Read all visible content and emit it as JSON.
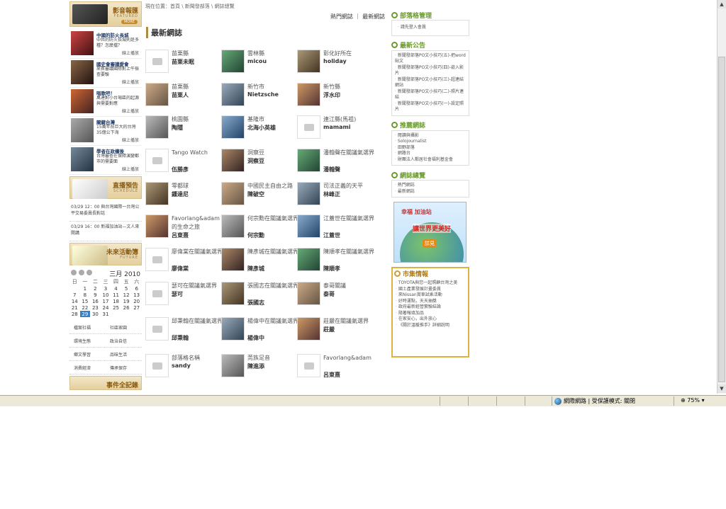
{
  "breadcrumb": "現在位置：首頁 \\ 新聞發部落 \\ 網誌總覽",
  "top_links": [
    "熱門網誌",
    "最新網誌"
  ],
  "main_title": "最新網誌",
  "left": {
    "featured_banner": {
      "title": "影音報匯",
      "sub": "FEATURED",
      "pill": "MORE"
    },
    "videos": [
      {
        "t1": "中國的防火長城",
        "t2": "中共的防火長城則是多種？怎麼擋？",
        "play": "線上播放"
      },
      {
        "t1": "國史會審議愛會",
        "t2": "來賓審議國際對上午檢查要驗",
        "play": "線上播放"
      },
      {
        "t1": "唱歌吧！",
        "t2": "萬達對小台場區的起源與需要對應",
        "play": "線上播放"
      },
      {
        "t1": "關鍵台灣",
        "t2": "15萬年前巨大的台灣35億公下海",
        "play": "線上播放"
      },
      {
        "t1": "學者在政權後",
        "t2": "台灣審查在保障演變都市的需要面",
        "play": "線上播放"
      }
    ],
    "schedule_banner": {
      "title": "直播預告",
      "sub": "SCHEDULE"
    },
    "schedule": [
      "03/29 12：00 與台灣國際一台灣公平交易委員長對話",
      "03/29 16：00 新福加油站—文人來開講"
    ],
    "future_banner": {
      "title": "未來活動簿",
      "sub": "FUTURE"
    },
    "calendar": {
      "month": "三月 2010",
      "weekdays": [
        "日",
        "一",
        "二",
        "三",
        "四",
        "五",
        "六"
      ],
      "rows": [
        [
          "",
          "1",
          "2",
          "3",
          "4",
          "5",
          "6"
        ],
        [
          "7",
          "8",
          "9",
          "10",
          "11",
          "12",
          "13"
        ],
        [
          "14",
          "15",
          "16",
          "17",
          "18",
          "19",
          "20"
        ],
        [
          "21",
          "22",
          "23",
          "24",
          "25",
          "26",
          "27"
        ],
        [
          "28",
          "29",
          "30",
          "31",
          "",
          "",
          ""
        ]
      ],
      "today": "29"
    },
    "categories": [
      [
        "檔案社福",
        "社區家園"
      ],
      [
        "環境生態",
        "政治自信"
      ],
      [
        "鄉文學習",
        "品味生活"
      ],
      [
        "消費經濟",
        "傳承保存"
      ]
    ],
    "bottom_banner": {
      "title": "事件全記錄"
    }
  },
  "blogs": [
    [
      {
        "name": "苗栗縣",
        "user": "苗栗未眠",
        "avatar": "default"
      },
      {
        "name": "雲林縣",
        "user": "micou",
        "avatar": "photo"
      },
      {
        "name": "彰化好所在",
        "user": "holiday",
        "avatar": "photo"
      }
    ],
    [
      {
        "name": "苗栗縣",
        "user": "苗栗人",
        "avatar": "photo"
      },
      {
        "name": "新竹市",
        "user": "Nietzsche",
        "avatar": "photo"
      },
      {
        "name": "新竹縣",
        "user": "浮水印",
        "avatar": "photo"
      }
    ],
    [
      {
        "name": "桃園縣",
        "user": "陶隱",
        "avatar": "photo"
      },
      {
        "name": "基隆市",
        "user": "北海小英雄",
        "avatar": "photo"
      },
      {
        "name": "連江縣(馬祖)",
        "user": "mamami",
        "avatar": "default"
      }
    ],
    [
      {
        "name": "Tango Watch",
        "user": "伍勝彥",
        "avatar": "default"
      },
      {
        "name": "洞察豆",
        "user": "洞察豆",
        "avatar": "photo"
      },
      {
        "name": "潘翰聲在關議氣選界",
        "user": "潘翰聲",
        "avatar": "photo"
      }
    ],
    [
      {
        "name": "零都球",
        "user": "鍾達尼",
        "avatar": "photo"
      },
      {
        "name": "中國民主自由之路",
        "user": "陳破空",
        "avatar": "photo"
      },
      {
        "name": "司法正義的天平",
        "user": "林峰正",
        "avatar": "photo"
      }
    ],
    [
      {
        "name": "Favorlang&adam的生命之旅",
        "user": "呂東熹",
        "avatar": "photo"
      },
      {
        "name": "何宗勳在關議氣選界",
        "user": "何宗勳",
        "avatar": "photo"
      },
      {
        "name": "江蓋世在關議氣選界",
        "user": "江蓋世",
        "avatar": "photo"
      }
    ],
    [
      {
        "name": "廖偉棠在關議氣選界",
        "user": "廖偉棠",
        "avatar": "default"
      },
      {
        "name": "陳彥城在關議氣選界",
        "user": "陳彥城",
        "avatar": "photo"
      },
      {
        "name": "陳順孝在關議氣選界",
        "user": "陳順孝",
        "avatar": "photo"
      }
    ],
    [
      {
        "name": "瑟可在關議氣選界",
        "user": "瑟可",
        "avatar": "default"
      },
      {
        "name": "張國志在關議氣選界",
        "user": "張國志",
        "avatar": "photo"
      },
      {
        "name": "泰哥關議",
        "user": "泰哥",
        "avatar": "photo"
      }
    ],
    [
      {
        "name": "邱秉翰在關議氣選界",
        "user": "邱秉翰",
        "avatar": "default"
      },
      {
        "name": "楊偉中在關議氣選界",
        "user": "楊偉中",
        "avatar": "photo"
      },
      {
        "name": "莊嚴在關議氣選界",
        "user": "莊嚴",
        "avatar": "photo"
      }
    ],
    [
      {
        "name": "部落格名稱",
        "user": "sandy",
        "avatar": "default"
      },
      {
        "name": "莞族足音",
        "user": "陳進添",
        "avatar": "photo"
      },
      {
        "name": "Favorlang&adam",
        "user": "呂東熹",
        "avatar": "default"
      }
    ]
  ],
  "right": {
    "manage": {
      "title": "部落格管理",
      "items": [
        "請先登入會員"
      ]
    },
    "news": {
      "title": "最新公告",
      "items": [
        "新聞發部落PO文小技巧(五)-把word貼文",
        "新聞發部落PO文小技巧(四)-嵌入影片",
        "新聞發部落PO文小技巧(三)-超連結網站",
        "新聞發部落PO文小技巧(二)-照片連結",
        "新聞發部落PO文小技巧(一)-設定照片"
      ]
    },
    "recommend": {
      "title": "推薦網誌",
      "items": [
        "閱讀與攝影",
        "Solojournalist",
        "田野部落",
        "網路台",
        "財團法人鄰居社會福利基金會"
      ]
    },
    "overview": {
      "title": "網誌總覽",
      "items": [
        "熱門網誌",
        "最新網誌"
      ]
    },
    "ad": {
      "l1": "幸福 加油站",
      "l2": "讓世界更美好",
      "l3": "詳見"
    },
    "market": {
      "title": "市集情報",
      "items": [
        "TOYOTA與您一起照顧台灣之美",
        "國土產業發展計畫委員",
        "來Nissan賞車試乘活動",
        "好時運點，天天抽獎",
        "政府最新經營實驗結論",
        "隨著報填加品",
        "在家安心，出外放心",
        "《關於溫暖推手》詳細說明"
      ]
    }
  },
  "statusbar": {
    "zone": "網際網路 | 受保護模式: 關閉",
    "zoom": "75%"
  },
  "colors": {
    "accent_green": "#6a9a2c",
    "gold": "#b08a40",
    "today": "#3d7fbf"
  }
}
